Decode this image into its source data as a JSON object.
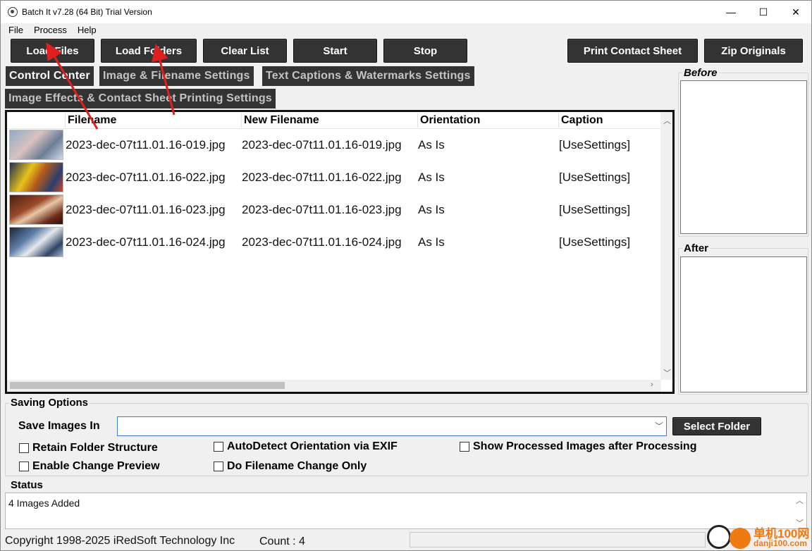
{
  "window": {
    "title": "Batch It v7.28 (64 Bit) Trial Version",
    "minimize_glyph": "—",
    "maximize_glyph": "☐",
    "close_glyph": "✕"
  },
  "menu": {
    "items": [
      "File",
      "Process",
      "Help"
    ]
  },
  "toolbar": {
    "load_files": "Load Files",
    "load_folders": "Load Folders",
    "clear_list": "Clear List",
    "start": "Start",
    "stop": "Stop",
    "print_contact_sheet": "Print Contact Sheet",
    "zip_originals": "Zip Originals"
  },
  "tabs": {
    "control_center": "Control Center",
    "image_filename": "Image & Filename Settings",
    "text_captions": "Text Captions & Watermarks Settings",
    "image_effects": "Image Effects & Contact Sheet Printing Settings"
  },
  "list": {
    "columns": [
      "Filename",
      "New Filename",
      "Orientation",
      "Caption"
    ],
    "rows": [
      {
        "filename": "2023-dec-07t11.01.16-019.jpg",
        "new_filename": "2023-dec-07t11.01.16-019.jpg",
        "orientation": "As Is",
        "caption": "[UseSettings]"
      },
      {
        "filename": "2023-dec-07t11.01.16-022.jpg",
        "new_filename": "2023-dec-07t11.01.16-022.jpg",
        "orientation": "As Is",
        "caption": "[UseSettings]"
      },
      {
        "filename": "2023-dec-07t11.01.16-023.jpg",
        "new_filename": "2023-dec-07t11.01.16-023.jpg",
        "orientation": "As Is",
        "caption": "[UseSettings]"
      },
      {
        "filename": "2023-dec-07t11.01.16-024.jpg",
        "new_filename": "2023-dec-07t11.01.16-024.jpg",
        "orientation": "As Is",
        "caption": "[UseSettings]"
      }
    ]
  },
  "preview": {
    "before_label": "Before",
    "after_label": "After"
  },
  "saving": {
    "group_title": "Saving Options",
    "save_images_in_label": "Save Images In",
    "save_images_in_value": "",
    "select_folder": "Select Folder",
    "retain_folder_structure": "Retain Folder Structure",
    "enable_change_preview": "Enable Change Preview",
    "autodetect_orientation": "AutoDetect Orientation via EXIF",
    "do_filename_change_only": "Do Filename Change Only",
    "show_processed_images": "Show Processed Images after Processing"
  },
  "status": {
    "title": "Status",
    "message": "4 Images Added"
  },
  "footer": {
    "copyright": "Copyright 1998-2025 iRedSoft Technology Inc",
    "count": "Count : 4"
  },
  "watermark": {
    "text_cn": "单机100网",
    "text_url": "danji100.com"
  },
  "colors": {
    "button_dark": "#333333",
    "arrow_red": "#e02020",
    "watermark_orange": "#f07a12"
  }
}
